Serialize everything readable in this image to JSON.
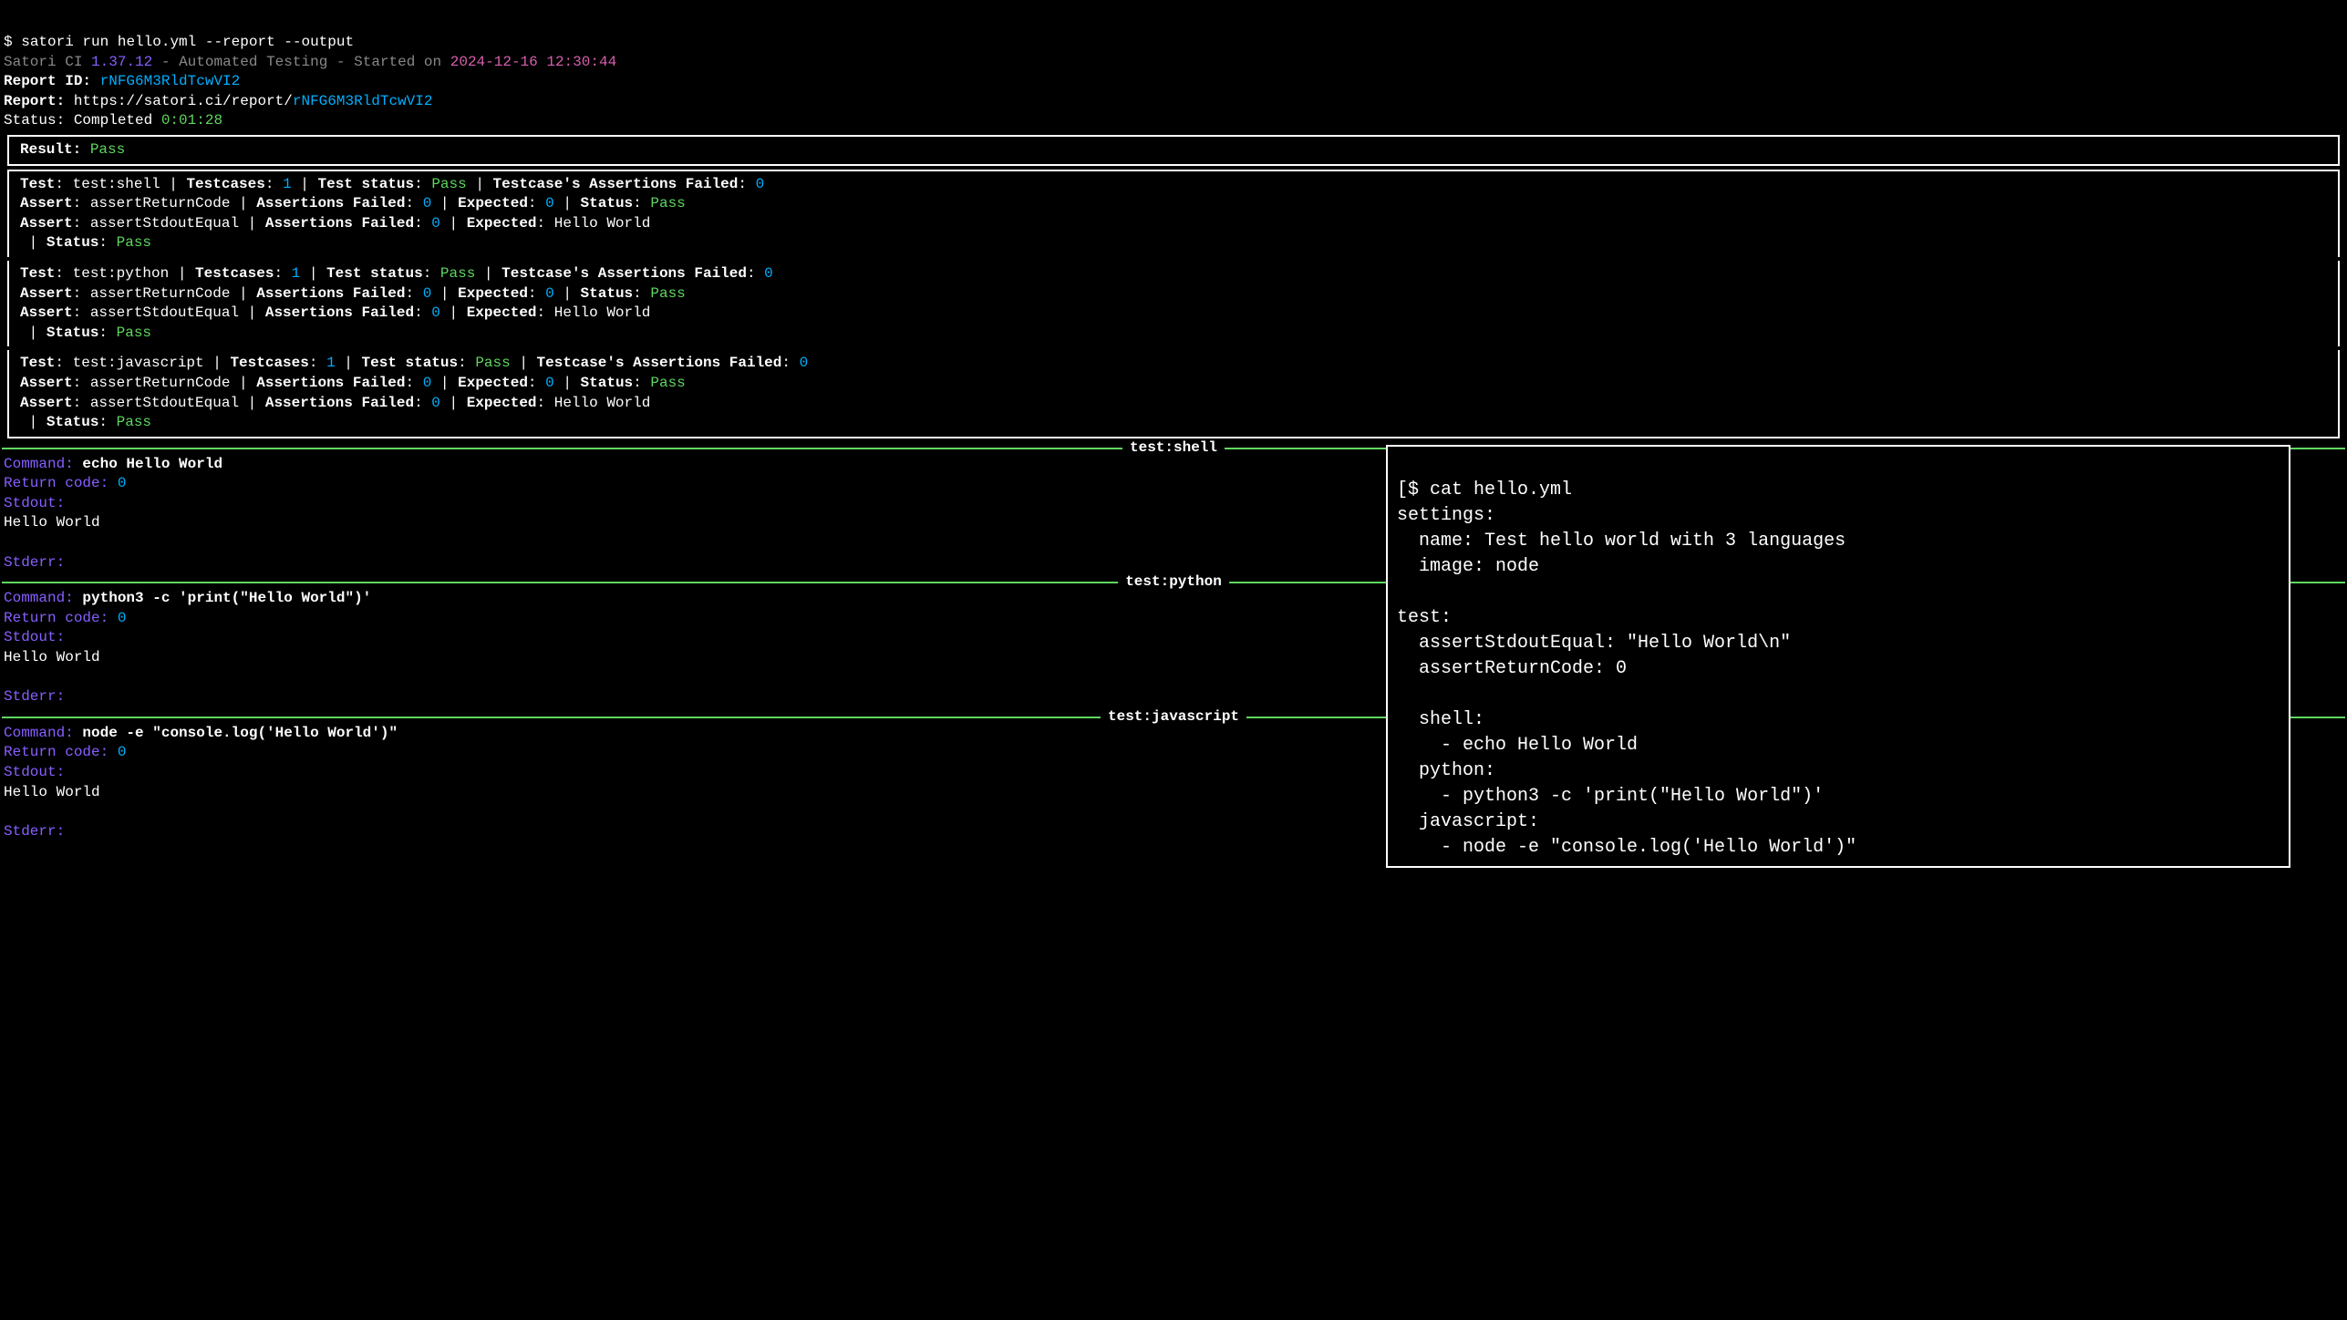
{
  "cmd": {
    "prompt": "$",
    "line": "satori run hello.yml --report --output"
  },
  "banner": {
    "app": "Satori CI",
    "version": "1.37.12",
    "dash1": " - ",
    "label2": "Automated Testing",
    "dash2": " - ",
    "label3": "Started on ",
    "date": "2024-12-16 12:30:44"
  },
  "report_id": {
    "label": "Report ID: ",
    "value": "rNFG6M3RldTcwVI2"
  },
  "report": {
    "label": "Report: ",
    "url_prefix": "https://satori.ci/report/",
    "url_id": "rNFG6M3RldTcwVI2"
  },
  "status": {
    "label": " Status: ",
    "value": "Completed ",
    "time": "0:01:28"
  },
  "result": {
    "label": "Result: ",
    "value": "Pass"
  },
  "tests": [
    {
      "name": "test:shell",
      "testcases": "1",
      "status": "Pass",
      "failed": "0",
      "asserts": [
        {
          "name": "assertReturnCode",
          "failed": "0",
          "expected": "0",
          "status": "Pass"
        },
        {
          "name": "assertStdoutEqual",
          "failed": "0",
          "expected": "Hello World",
          "status": "Pass"
        }
      ]
    },
    {
      "name": "test:python",
      "testcases": "1",
      "status": "Pass",
      "failed": "0",
      "asserts": [
        {
          "name": "assertReturnCode",
          "failed": "0",
          "expected": "0",
          "status": "Pass"
        },
        {
          "name": "assertStdoutEqual",
          "failed": "0",
          "expected": "Hello World",
          "status": "Pass"
        }
      ]
    },
    {
      "name": "test:javascript",
      "testcases": "1",
      "status": "Pass",
      "failed": "0",
      "asserts": [
        {
          "name": "assertReturnCode",
          "failed": "0",
          "expected": "0",
          "status": "Pass"
        },
        {
          "name": "assertStdoutEqual",
          "failed": "0",
          "expected": "Hello World",
          "status": "Pass"
        }
      ]
    }
  ],
  "outputs": [
    {
      "title": "test:shell",
      "command": "echo Hello World",
      "rc": "0",
      "stdout": "Hello World"
    },
    {
      "title": "test:python",
      "command": "python3 -c 'print(\"Hello World\")'",
      "rc": "0",
      "stdout": "Hello World"
    },
    {
      "title": "test:javascript",
      "command": "node -e \"console.log('Hello World')\"",
      "rc": "0",
      "stdout": "Hello World"
    }
  ],
  "labels": {
    "test": "Test",
    "testcases": "Testcases",
    "test_status": "Test status",
    "tc_failed": "Testcase's Assertions Failed",
    "assert": "Assert",
    "a_failed": "Assertions Failed",
    "expected": "Expected",
    "status_l": "Status",
    "command": "Command:",
    "return_code": "Return code:",
    "stdout": "Stdout:",
    "stderr": "Stderr:"
  },
  "overlay": {
    "line1": "[$ cat hello.yml",
    "content": "settings:\n  name: Test hello world with 3 languages\n  image: node\n\ntest:\n  assertStdoutEqual: \"Hello World\\n\"\n  assertReturnCode: 0\n\n  shell:\n    - echo Hello World\n  python:\n    - python3 -c 'print(\"Hello World\")'\n  javascript:\n    - node -e \"console.log('Hello World')\""
  }
}
